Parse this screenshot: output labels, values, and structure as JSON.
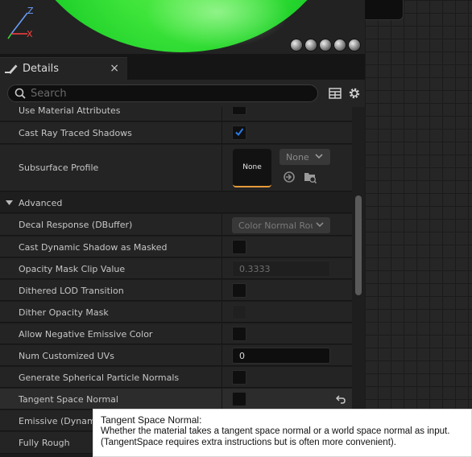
{
  "viewport": {
    "axis_z": "Z",
    "axis_x": "X",
    "shape_buttons": [
      "sphere-icon",
      "cylinder-icon",
      "plane-icon",
      "cube-icon",
      "teapot-icon"
    ]
  },
  "details_tab": {
    "icon": "pencil-icon",
    "label": "Details",
    "close_label": "×"
  },
  "search": {
    "placeholder": "Search"
  },
  "rows": [
    {
      "label": "Use Material Attributes"
    },
    {
      "label": "Cast Ray Traced Shadows",
      "checked": true
    },
    {
      "label": "Subsurface Profile",
      "thumb_label": "None",
      "dropdown_value": "None"
    },
    {
      "label": "Advanced",
      "is_section": true
    },
    {
      "label": "Decal Response (DBuffer)",
      "dropdown_value": "Color Normal Roughness"
    },
    {
      "label": "Cast Dynamic Shadow as Masked",
      "checked": false
    },
    {
      "label": "Opacity Mask Clip Value",
      "value": "0.3333"
    },
    {
      "label": "Dithered LOD Transition",
      "checked": false
    },
    {
      "label": "Dither Opacity Mask",
      "checked": false,
      "disabled": true
    },
    {
      "label": "Allow Negative Emissive Color",
      "checked": false
    },
    {
      "label": "Num Customized UVs",
      "value": "0"
    },
    {
      "label": "Generate Spherical Particle Normals",
      "checked": false
    },
    {
      "label": "Tangent Space Normal",
      "checked": false
    },
    {
      "label": "Emissive (Dynam"
    },
    {
      "label": "Fully Rough"
    }
  ],
  "tooltip": {
    "title": "Tangent Space Normal:",
    "line1": "Whether the material takes a tangent space normal or a world space normal as input.",
    "line2": "(TangentSpace requires extra instructions but is often more convenient)."
  },
  "colors": {
    "accent_check": "#2b7be3",
    "preview_green": "#3ee43a",
    "thumb_underline": "#e59b3b"
  }
}
